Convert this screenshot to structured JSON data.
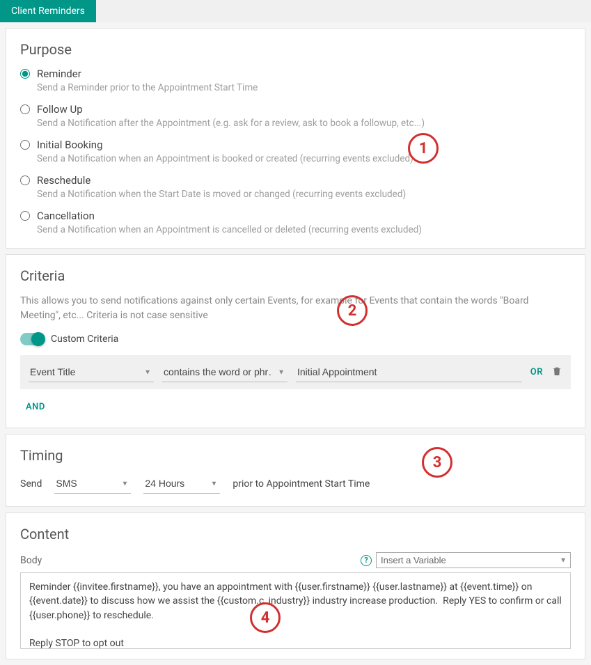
{
  "tab": {
    "label": "Client Reminders"
  },
  "purpose": {
    "title": "Purpose",
    "options": [
      {
        "label": "Reminder",
        "desc": "Send a Reminder prior to the Appointment Start Time",
        "checked": true
      },
      {
        "label": "Follow Up",
        "desc": "Send a Notification after the Appointment (e.g. ask for a review, ask to book a followup, etc...)",
        "checked": false
      },
      {
        "label": "Initial Booking",
        "desc": "Send a Notification when an Appointment is booked or created (recurring events excluded)",
        "checked": false
      },
      {
        "label": "Reschedule",
        "desc": "Send a Notification when the Start Date is moved or changed (recurring events excluded)",
        "checked": false
      },
      {
        "label": "Cancellation",
        "desc": "Send a Notification when an Appointment is cancelled or deleted (recurring events excluded)",
        "checked": false
      }
    ]
  },
  "criteria": {
    "title": "Criteria",
    "desc": "This allows you to send notifications against only certain Events, for example for Events that contain the words \"Board Meeting\", etc... Criteria is not case sensitive",
    "toggle_label": "Custom Criteria",
    "field": "Event Title",
    "operator": "contains the word or phr…",
    "value": "Initial Appointment",
    "or_label": "OR",
    "and_label": "AND"
  },
  "timing": {
    "title": "Timing",
    "send_label": "Send",
    "method": "SMS",
    "delay": "24 Hours",
    "suffix": "prior to Appointment Start Time"
  },
  "content": {
    "title": "Content",
    "body_label": "Body",
    "variable_placeholder": "Insert a Variable",
    "body_text": "Reminder {{invitee.firstname}}, you have an appointment with {{user.firstname}} {{user.lastname}} at {{event.time}} on {{event.date}} to discuss how we assist the {{custom.c_industry}} industry increase production.  Reply YES to confirm or call {{user.phone}} to reschedule.\n\nReply STOP to opt out"
  },
  "annotations": {
    "1": "1",
    "2": "2",
    "3": "3",
    "4": "4"
  }
}
